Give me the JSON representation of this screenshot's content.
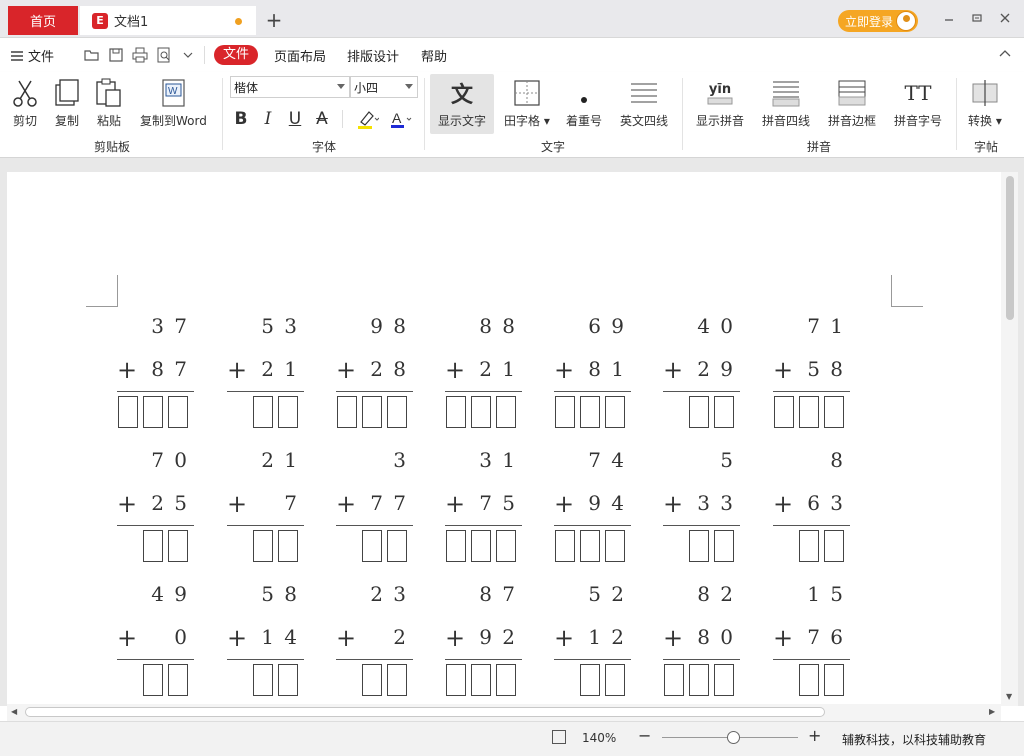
{
  "tabs": {
    "home": "首页",
    "doc": "文档1",
    "doc_logo": "E",
    "new_tab": "+"
  },
  "account": {
    "login_label": "立即登录"
  },
  "window_controls": {
    "minimize": "▭",
    "restore": "▭",
    "close": "✕"
  },
  "menu": {
    "file_label": "文件",
    "items": [
      "文件",
      "页面布局",
      "排版设计",
      "帮助"
    ],
    "active": "文件",
    "collapse": "︿"
  },
  "quick_toolbar": [
    "open-icon",
    "save-icon",
    "print-icon",
    "print-preview-icon",
    "dropdown-icon"
  ],
  "ribbon": {
    "clipboard": {
      "label": "剪贴板",
      "buttons": [
        "剪切",
        "复制",
        "粘贴",
        "复制到Word"
      ]
    },
    "font": {
      "label": "字体",
      "font_name": "楷体",
      "font_size": "小四",
      "bold": "B",
      "italic": "I",
      "underline": "U",
      "strikethrough": "A",
      "highlight": "✎",
      "font_color": "A"
    },
    "text": {
      "label": "文字",
      "show_text": "显示文字",
      "show_text_glyph": "文",
      "grid": "田字格",
      "emphasis": "着重号",
      "english_lines": "英文四线"
    },
    "pinyin": {
      "label": "拼音",
      "show_pinyin": "显示拼音",
      "pinyin_glyph": "yīn",
      "four_lines": "拼音四线",
      "border": "拼音边框",
      "font_size": "拼音字号",
      "font_size_glyph": "TT"
    },
    "post": {
      "label": "字帖",
      "convert": "转换"
    },
    "colors": {
      "accent": "#d9252a",
      "login": "#f5a623"
    }
  },
  "document": {
    "problems": [
      [
        {
          "a": "3 7",
          "b": "8 7",
          "boxes": 3
        },
        {
          "a": "5 3",
          "b": "2 1",
          "boxes": 2
        },
        {
          "a": "9 8",
          "b": "2 8",
          "boxes": 3
        },
        {
          "a": "8 8",
          "b": "2 1",
          "boxes": 3
        },
        {
          "a": "6 9",
          "b": "8 1",
          "boxes": 3
        },
        {
          "a": "4 0",
          "b": "2 9",
          "boxes": 2
        },
        {
          "a": "7 1",
          "b": "5 8",
          "boxes": 3
        }
      ],
      [
        {
          "a": "7 0",
          "b": "2 5",
          "boxes": 2
        },
        {
          "a": "2 1",
          "b": "7",
          "boxes": 2
        },
        {
          "a": "3",
          "b": "7 7",
          "boxes": 2
        },
        {
          "a": "3 1",
          "b": "7 5",
          "boxes": 3
        },
        {
          "a": "7 4",
          "b": "9 4",
          "boxes": 3
        },
        {
          "a": "5",
          "b": "3 3",
          "boxes": 2
        },
        {
          "a": "8",
          "b": "6 3",
          "boxes": 2
        }
      ],
      [
        {
          "a": "4 9",
          "b": "0",
          "boxes": 2
        },
        {
          "a": "5 8",
          "b": "1 4",
          "boxes": 2
        },
        {
          "a": "2 3",
          "b": "2",
          "boxes": 2
        },
        {
          "a": "8 7",
          "b": "9 2",
          "boxes": 3
        },
        {
          "a": "5 2",
          "b": "1 2",
          "boxes": 2
        },
        {
          "a": "8 2",
          "b": "8 0",
          "boxes": 3
        },
        {
          "a": "1 5",
          "b": "7 6",
          "boxes": 2
        }
      ]
    ],
    "operator": "+"
  },
  "status": {
    "zoom": "140%",
    "zoom_level": 0.52,
    "zoom_out": "−",
    "zoom_in": "+",
    "slogan": "辅教科技，以科技辅助教育"
  }
}
